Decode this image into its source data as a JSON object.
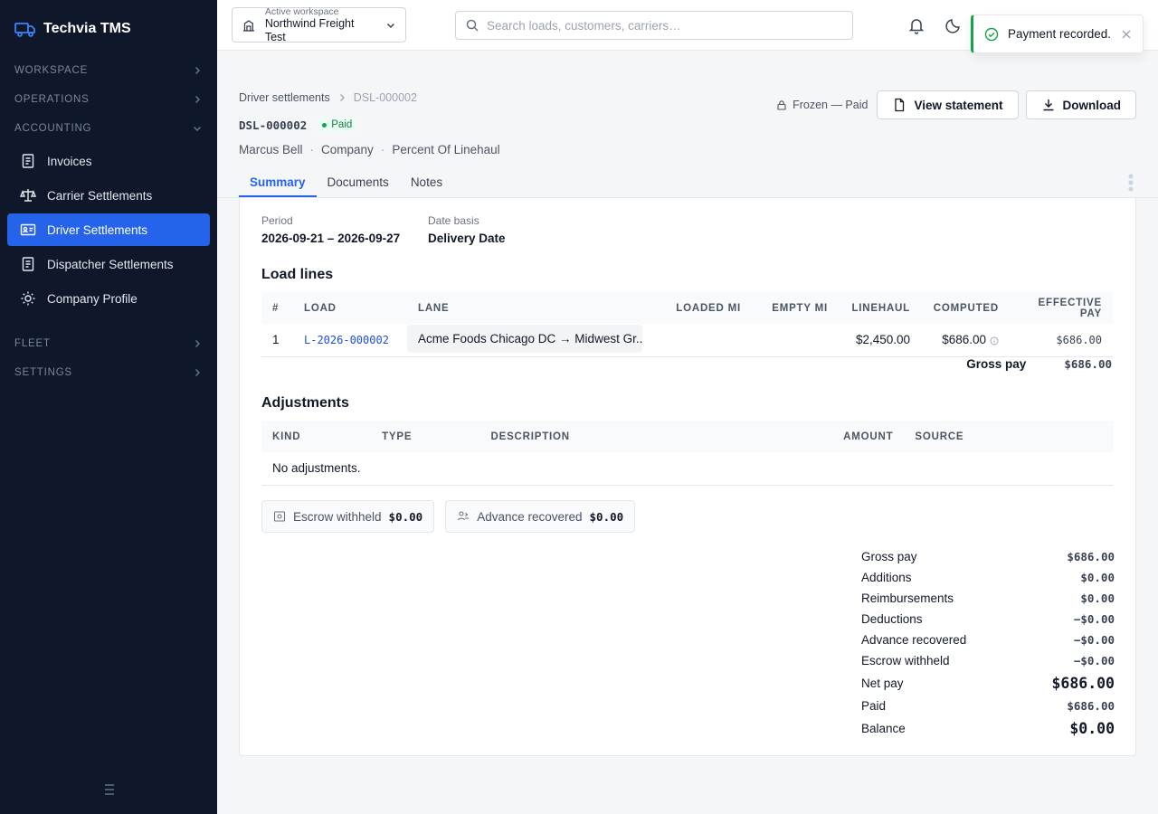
{
  "app": {
    "name": "Techvia TMS"
  },
  "sidebar": {
    "sections": [
      {
        "label": "WORKSPACE"
      },
      {
        "label": "OPERATIONS"
      },
      {
        "label": "ACCOUNTING"
      },
      {
        "label": "FLEET"
      },
      {
        "label": "SETTINGS"
      }
    ],
    "accounting_items": [
      {
        "label": "Invoices",
        "icon": "receipt-icon"
      },
      {
        "label": "Carrier Settlements",
        "icon": "scales-icon"
      },
      {
        "label": "Driver Settlements",
        "icon": "id-card-icon",
        "active": true
      },
      {
        "label": "Dispatcher Settlements",
        "icon": "receipt-icon"
      },
      {
        "label": "Company Profile",
        "icon": "sun-icon"
      }
    ]
  },
  "topbar": {
    "workspace_label": "Active workspace",
    "workspace_name": "Northwind Freight Test",
    "search_placeholder": "Search loads, customers, carriers…"
  },
  "toast": {
    "message": "Payment recorded."
  },
  "breadcrumb": {
    "parent": "Driver settlements",
    "current": "DSL-000002"
  },
  "header": {
    "doc_id": "DSL-000002",
    "status": "Paid",
    "driver": "Marcus Bell",
    "driver_type": "Company",
    "pay_basis": "Percent Of Linehaul",
    "frozen_label": "Frozen — Paid",
    "view_statement": "View statement",
    "download": "Download"
  },
  "tabs": [
    {
      "label": "Summary",
      "active": true
    },
    {
      "label": "Documents"
    },
    {
      "label": "Notes"
    }
  ],
  "summary": {
    "period_label": "Period",
    "period_value": "2026-09-21 – 2026-09-27",
    "basis_label": "Date basis",
    "basis_value": "Delivery Date"
  },
  "load_lines": {
    "title": "Load lines",
    "columns": [
      "#",
      "LOAD",
      "LANE",
      "LOADED MI",
      "EMPTY MI",
      "LINEHAUL",
      "COMPUTED",
      "EFFECTIVE PAY"
    ],
    "rows": [
      {
        "num": "1",
        "load": "L-2026-000002",
        "lane": "Acme Foods Chicago DC → Midwest Gr...",
        "loaded_mi": "",
        "empty_mi": "",
        "linehaul": "$2,450.00",
        "computed": "$686.00",
        "effective_pay": "$686.00"
      }
    ],
    "gross_label": "Gross pay",
    "gross_value": "$686.00"
  },
  "adjustments": {
    "title": "Adjustments",
    "columns": [
      "KIND",
      "TYPE",
      "DESCRIPTION",
      "AMOUNT",
      "SOURCE"
    ],
    "empty": "No adjustments."
  },
  "chips": [
    {
      "label": "Escrow withheld",
      "value": "$0.00",
      "icon": "safe-icon"
    },
    {
      "label": "Advance recovered",
      "value": "$0.00",
      "icon": "user-cash-icon"
    }
  ],
  "totals": [
    {
      "label": "Gross pay",
      "value": "$686.00"
    },
    {
      "label": "Additions",
      "value": "$0.00"
    },
    {
      "label": "Reimbursements",
      "value": "$0.00"
    },
    {
      "label": "Deductions",
      "value": "−$0.00"
    },
    {
      "label": "Advance recovered",
      "value": "−$0.00"
    },
    {
      "label": "Escrow withheld",
      "value": "−$0.00"
    },
    {
      "label": "Net pay",
      "value": "$686.00",
      "big": true
    },
    {
      "label": "Paid",
      "value": "$686.00"
    },
    {
      "label": "Balance",
      "value": "$0.00",
      "big": true
    }
  ]
}
